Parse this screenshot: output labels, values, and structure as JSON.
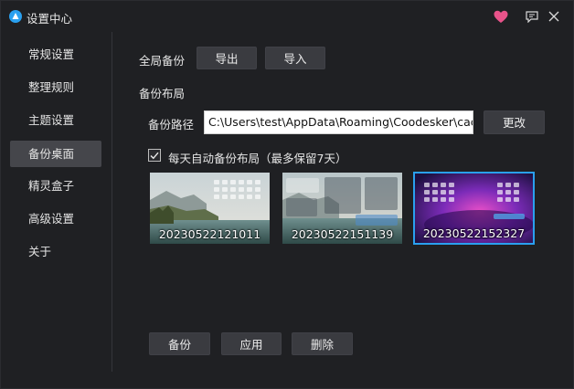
{
  "window": {
    "title": "设置中心",
    "accent_color": "#2aa0ef",
    "heart_color": "#e8538a"
  },
  "sidebar": {
    "items": [
      {
        "label": "常规设置",
        "active": false
      },
      {
        "label": "整理规则",
        "active": false
      },
      {
        "label": "主题设置",
        "active": false
      },
      {
        "label": "备份桌面",
        "active": true
      },
      {
        "label": "精灵盒子",
        "active": false
      },
      {
        "label": "高级设置",
        "active": false
      },
      {
        "label": "关于",
        "active": false
      }
    ]
  },
  "main": {
    "global_backup": {
      "label": "全局备份",
      "export_label": "导出",
      "import_label": "导入"
    },
    "layout_backup": {
      "section_label": "备份布局",
      "path_label": "备份路径",
      "path_value": "C:\\Users\\test\\AppData\\Roaming\\Coodesker\\cach",
      "change_label": "更改",
      "auto_backup_label": "每天自动备份布局（最多保留7天）",
      "auto_backup_checked": true
    },
    "snapshots": [
      {
        "name": "20230522121011",
        "selected": false
      },
      {
        "name": "20230522151139",
        "selected": false
      },
      {
        "name": "20230522152327",
        "selected": true
      }
    ],
    "actions": {
      "backup_label": "备份",
      "apply_label": "应用",
      "delete_label": "删除"
    }
  }
}
